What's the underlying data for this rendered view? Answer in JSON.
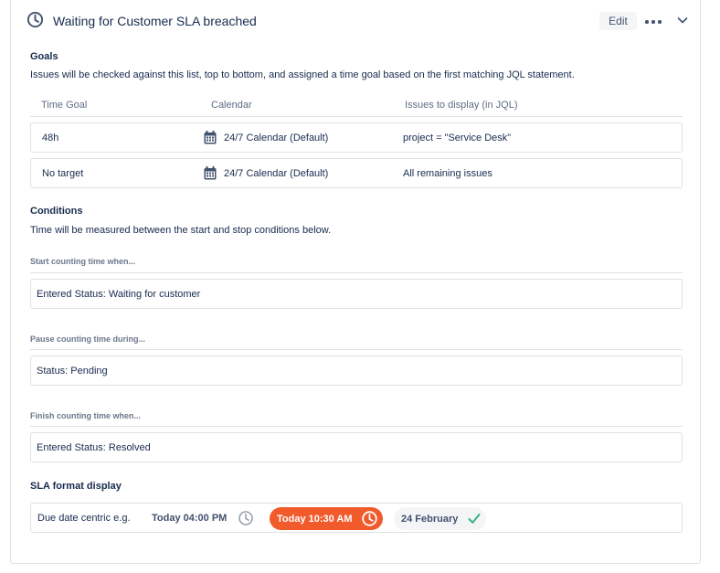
{
  "header": {
    "title": "Waiting for Customer SLA breached",
    "edit_label": "Edit"
  },
  "goals": {
    "title": "Goals",
    "description": "Issues will be checked against this list, top to bottom, and assigned a time goal based on the first matching JQL statement.",
    "columns": [
      "Time Goal",
      "Calendar",
      "Issues to display (in JQL)"
    ],
    "rows": [
      {
        "time_goal": "48h",
        "calendar": "24/7 Calendar (Default)",
        "jql": "project = \"Service Desk\""
      },
      {
        "time_goal": "No target",
        "calendar": "24/7 Calendar (Default)",
        "jql": "All remaining issues"
      }
    ]
  },
  "conditions": {
    "title": "Conditions",
    "description": "Time will be measured between the start and stop conditions below.",
    "start_label": "Start counting time when...",
    "start_value": "Entered Status: Waiting for customer",
    "pause_label": "Pause counting time during...",
    "pause_value": "Status: Pending",
    "finish_label": "Finish counting time when...",
    "finish_value": "Entered Status: Resolved"
  },
  "sla_format": {
    "title": "SLA format display",
    "label": "Due date centric e.g.",
    "example_normal": "Today 04:00 PM",
    "example_breached": "Today 10:30 AM",
    "example_met": "24 February"
  },
  "colors": {
    "text": "#172b4d",
    "subtle": "#6b778c",
    "border": "#dfe1e6",
    "breached": "#f15a2b",
    "met": "#36b37e",
    "neutral_pill": "#f4f5f7"
  },
  "icons": {
    "header": "clock-icon",
    "calendar": "calendar-icon",
    "more": "more-horizontal-icon",
    "collapse": "chevron-down-icon",
    "met": "check-icon"
  }
}
